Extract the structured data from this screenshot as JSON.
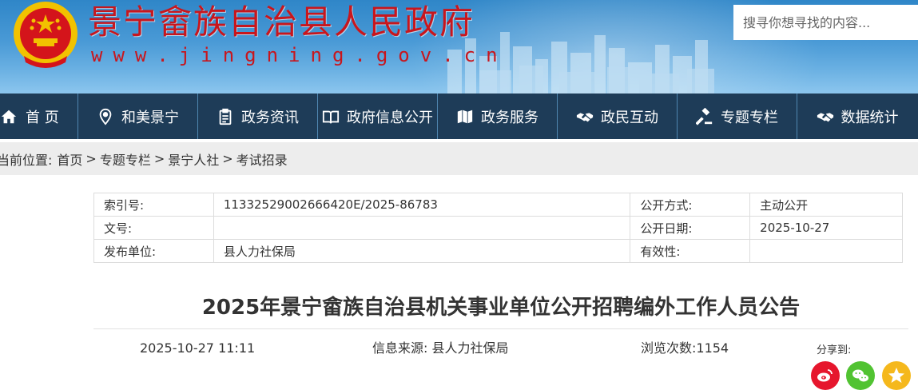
{
  "header": {
    "site_title": "景宁畲族自治县人民政府",
    "site_domain": "www.jingning.gov.cn",
    "search_placeholder": "搜寻你想寻找的内容...",
    "title_color": "#c8161d"
  },
  "nav": {
    "items": [
      {
        "label": "首 页",
        "icon": "home-icon"
      },
      {
        "label": "和美景宁",
        "icon": "location-pin-icon"
      },
      {
        "label": "政务资讯",
        "icon": "clipboard-icon"
      },
      {
        "label": "政府信息公开",
        "icon": "open-book-icon"
      },
      {
        "label": "政务服务",
        "icon": "map-icon"
      },
      {
        "label": "政民互动",
        "icon": "handshake-icon"
      },
      {
        "label": "专题专栏",
        "icon": "gavel-icon"
      },
      {
        "label": "数据统计",
        "icon": "handshake-icon"
      }
    ],
    "background": "#1e3c58"
  },
  "breadcrumb": {
    "prefix": "当前位置:",
    "items": [
      "首页",
      "专题专栏",
      "景宁人社",
      "考试招录"
    ],
    "separator": ">"
  },
  "meta": {
    "rows": [
      [
        "索引号:",
        "11332529002666420E/2025-86783",
        "公开方式:",
        "主动公开"
      ],
      [
        "文号:",
        "",
        "公开日期:",
        "2025-10-27"
      ],
      [
        "发布单位:",
        "县人力社保局",
        "有效性:",
        ""
      ]
    ]
  },
  "article": {
    "title": "2025年景宁畲族自治县机关事业单位公开招聘编外工作人员公告",
    "date": "2025-10-27 11:11",
    "source": "信息来源:  县人力社保局",
    "views": "浏览次数:1154",
    "share_label": "分享到:"
  },
  "share": [
    {
      "icon": "weibo-icon",
      "color": "#e6162d"
    },
    {
      "icon": "wechat-icon",
      "color": "#51c332"
    },
    {
      "icon": "qzone-icon",
      "color": "#f5b81c"
    }
  ]
}
